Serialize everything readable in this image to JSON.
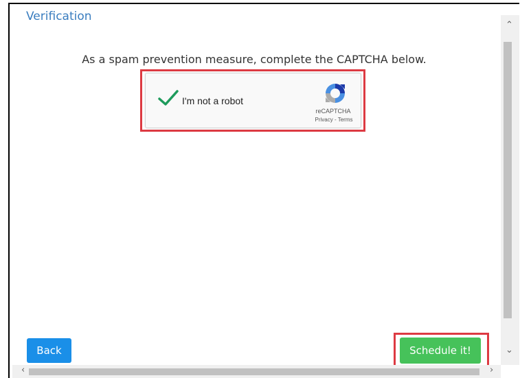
{
  "verification": {
    "title": "Verification",
    "instruction": "As a spam prevention measure, complete the CAPTCHA below."
  },
  "captcha": {
    "checkbox_label": "I'm not a robot",
    "checked": true,
    "brand": "reCAPTCHA",
    "privacy_link": "Privacy",
    "separator": " - ",
    "terms_link": "Terms"
  },
  "buttons": {
    "back_label": "Back",
    "schedule_label": "Schedule it!"
  },
  "colors": {
    "title": "#3a7dbf",
    "back_button": "#1a8fe8",
    "schedule_button": "#46c25a",
    "highlight": "#dd3a42",
    "check": "#1e9b5c"
  },
  "icons": {
    "check": "check-icon",
    "recaptcha": "recaptcha-logo-icon",
    "scroll_up": "chevron-up-icon",
    "scroll_down": "chevron-down-icon",
    "scroll_left": "chevron-left-icon",
    "scroll_right": "chevron-right-icon"
  }
}
